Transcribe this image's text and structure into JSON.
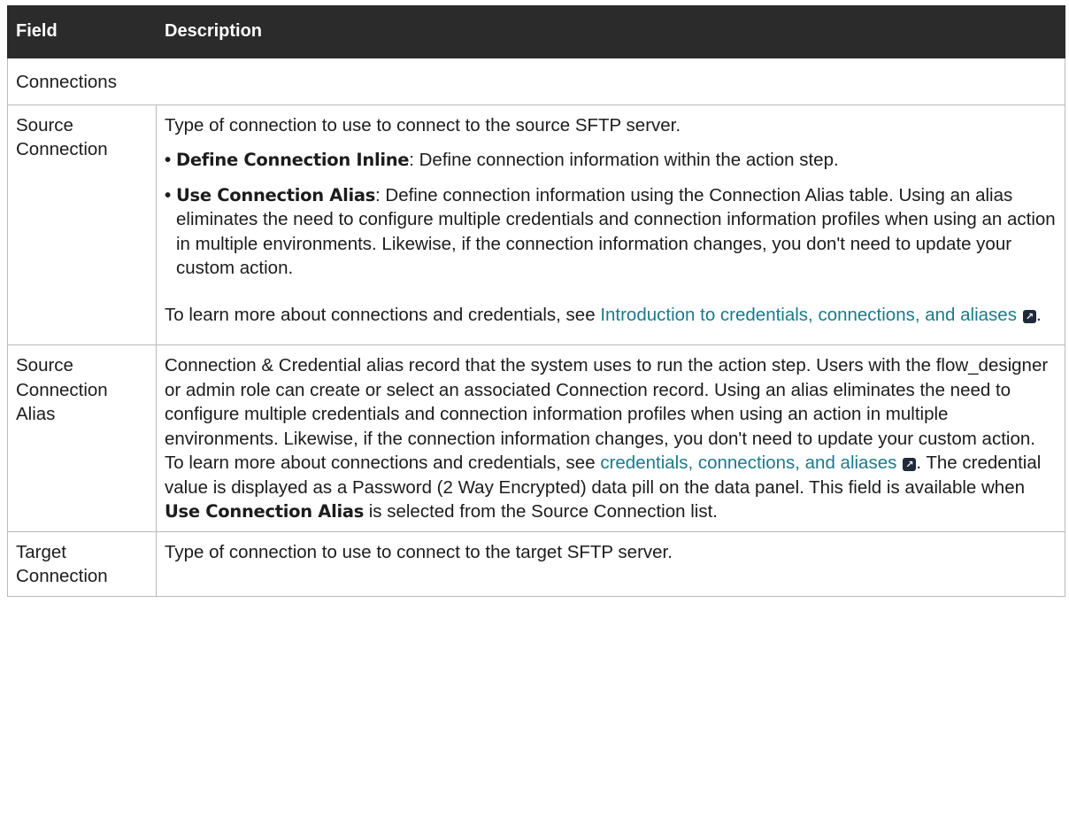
{
  "header": {
    "field": "Field",
    "description": "Description"
  },
  "section": "Connections",
  "rows": {
    "source_connection": {
      "field": "Source Connection",
      "intro": "Type of connection to use to connect to the source SFTP server.",
      "bullets": [
        {
          "term": "Define Connection Inline",
          "text": ": Define connection information within the action step."
        },
        {
          "term": "Use Connection Alias",
          "text": ": Define connection information using the Connection Alias table. Using an alias eliminates the need to configure multiple credentials and connection information profiles when using an action in multiple environments. Likewise, if the connection information changes, you don't need to update your custom action."
        }
      ],
      "learn_prefix": "To learn more about connections and credentials, see ",
      "learn_link": "Introduction to credentials, connections, and aliases",
      "learn_suffix": "."
    },
    "source_connection_alias": {
      "field": "Source Connection Alias",
      "text1": "Connection & Credential alias record that the system uses to run the action step. Users with the flow_designer or admin role can create or select an associated Connection record. Using an alias eliminates the need to configure multiple credentials and connection information profiles when using an action in multiple environments. Likewise, if the connection information changes, you don't need to update your custom action. To learn more about connections and credentials, see ",
      "link": "credentials, connections, and aliases",
      "text2": ".  The credential value is displayed as a Password (2 Way Encrypted) data pill on the data panel. This field is available when ",
      "term": "Use Connection Alias",
      "text3": " is selected from the Source Connection list."
    },
    "target_connection": {
      "field": "Target Connection",
      "intro": "Type of connection to use to connect to the target SFTP server."
    }
  },
  "icons": {
    "external_link": "external-link-icon",
    "bullet": "•"
  }
}
